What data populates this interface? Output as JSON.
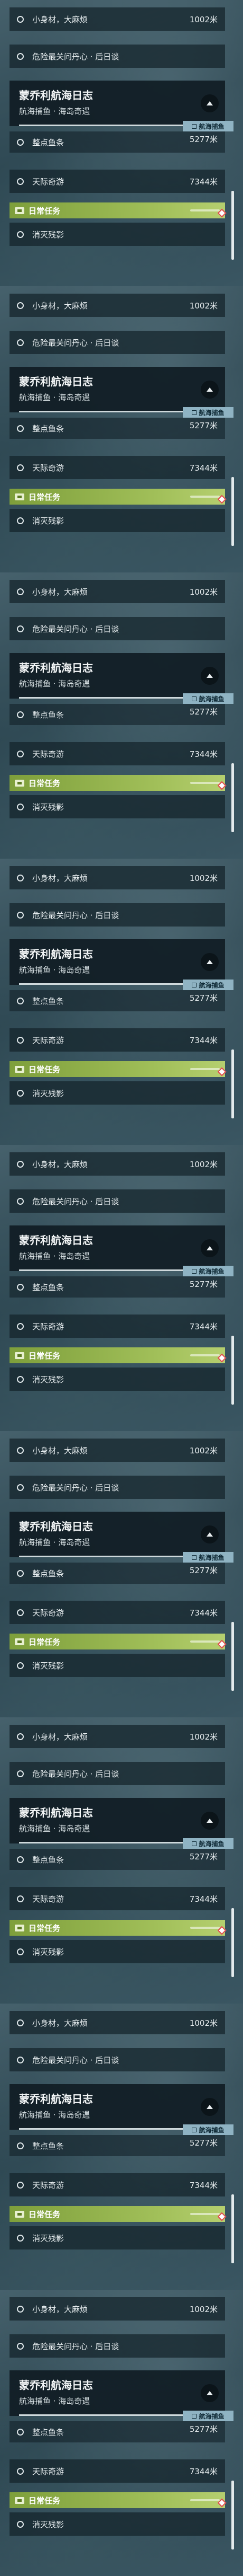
{
  "rows": {
    "item1": {
      "label": "小身材，大麻烦",
      "distance": "1002米"
    },
    "item2": {
      "label": "危险最关问丹心 · 后日谈"
    },
    "header": {
      "title": "蒙乔利航海日志",
      "subtitle": "航海捕鱼 · 海岛奇遇"
    },
    "badge": "航海捕鱼",
    "item3": {
      "label": "整点鱼条",
      "distance": "5277米"
    },
    "item4": {
      "label": "天际奇游",
      "distance": "7344米"
    },
    "daily": "日常任务",
    "item5": {
      "label": "消灭残影"
    }
  },
  "icons": {
    "up": "chevron-up-icon",
    "circle": "task-circle-icon",
    "daily": "daily-task-icon",
    "diamond": "waypoint-diamond-icon"
  },
  "colors": {
    "daily_bar": "#a2c05a",
    "badge": "#8fb3c3",
    "marker": "#e04848"
  }
}
